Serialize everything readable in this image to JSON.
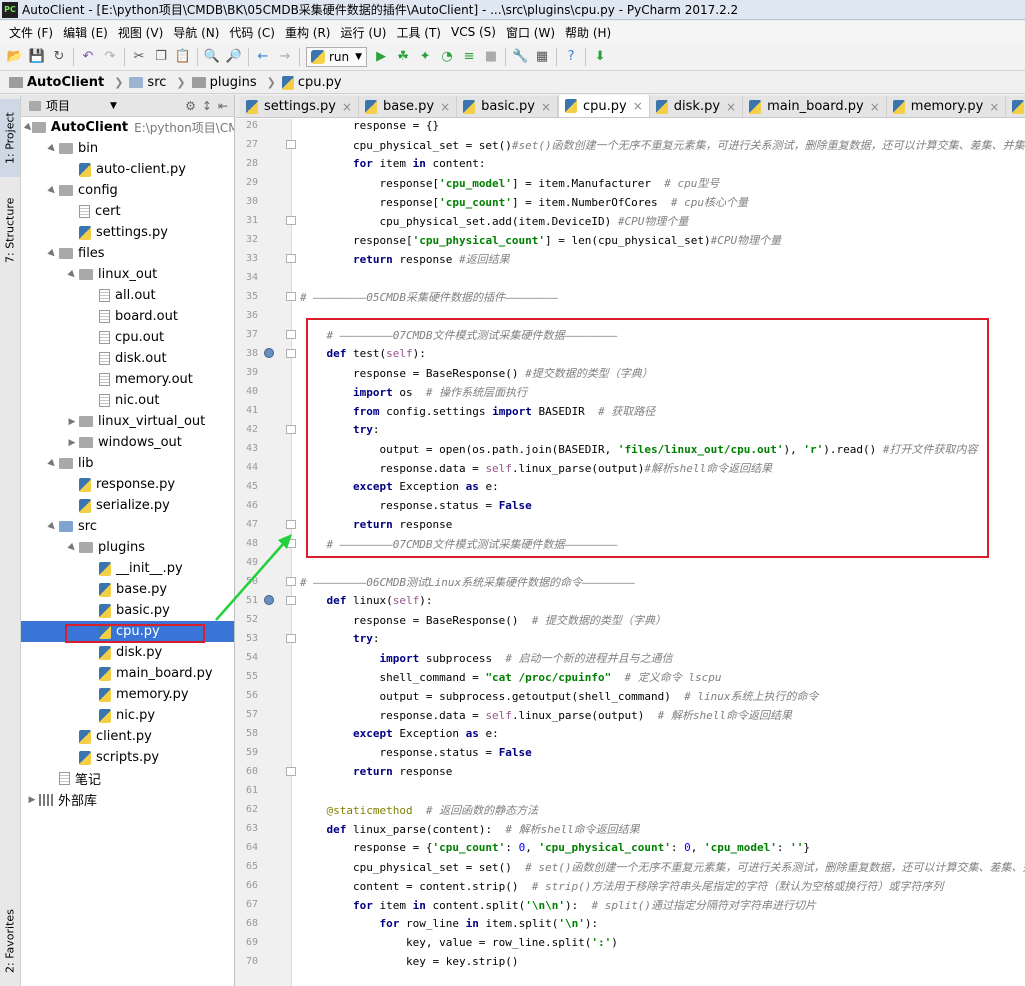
{
  "window": {
    "title": "AutoClient - [E:\\python项目\\CMDB\\BK\\05CMDB采集硬件数据的插件\\AutoClient] - ...\\src\\plugins\\cpu.py - PyCharm 2017.2.2",
    "logo": "PC"
  },
  "menu": [
    "文件 (F)",
    "编辑 (E)",
    "视图 (V)",
    "导航 (N)",
    "代码 (C)",
    "重构 (R)",
    "运行 (U)",
    "工具 (T)",
    "VCS (S)",
    "窗口 (W)",
    "帮助 (H)"
  ],
  "toolbar": {
    "run_config": "run"
  },
  "breadcrumb": [
    "AutoClient",
    "src",
    "plugins",
    "cpu.py"
  ],
  "sidebar_tabs": {
    "project": "1: Project",
    "structure": "7: Structure",
    "favorites": "2: Favorites"
  },
  "project_panel": {
    "title": "项目",
    "root_path": "E:\\python项目\\CMDB",
    "tree": [
      {
        "label": "AutoClient",
        "depth": 0,
        "icon": "folder",
        "expanded": true,
        "bold": true
      },
      {
        "label": "bin",
        "depth": 1,
        "icon": "folder",
        "expanded": true
      },
      {
        "label": "auto-client.py",
        "depth": 2,
        "icon": "py"
      },
      {
        "label": "config",
        "depth": 1,
        "icon": "folder",
        "expanded": true
      },
      {
        "label": "cert",
        "depth": 2,
        "icon": "file"
      },
      {
        "label": "settings.py",
        "depth": 2,
        "icon": "py"
      },
      {
        "label": "files",
        "depth": 1,
        "icon": "folder",
        "expanded": true
      },
      {
        "label": "linux_out",
        "depth": 2,
        "icon": "folder",
        "expanded": true
      },
      {
        "label": "all.out",
        "depth": 3,
        "icon": "file"
      },
      {
        "label": "board.out",
        "depth": 3,
        "icon": "file"
      },
      {
        "label": "cpu.out",
        "depth": 3,
        "icon": "file"
      },
      {
        "label": "disk.out",
        "depth": 3,
        "icon": "file"
      },
      {
        "label": "memory.out",
        "depth": 3,
        "icon": "file"
      },
      {
        "label": "nic.out",
        "depth": 3,
        "icon": "file"
      },
      {
        "label": "linux_virtual_out",
        "depth": 2,
        "icon": "folder",
        "expanded": false
      },
      {
        "label": "windows_out",
        "depth": 2,
        "icon": "folder",
        "expanded": false
      },
      {
        "label": "lib",
        "depth": 1,
        "icon": "folder",
        "expanded": true
      },
      {
        "label": "response.py",
        "depth": 2,
        "icon": "py"
      },
      {
        "label": "serialize.py",
        "depth": 2,
        "icon": "py"
      },
      {
        "label": "src",
        "depth": 1,
        "icon": "folder",
        "expanded": true
      },
      {
        "label": "plugins",
        "depth": 2,
        "icon": "folder",
        "expanded": true
      },
      {
        "label": "__init__.py",
        "depth": 3,
        "icon": "py"
      },
      {
        "label": "base.py",
        "depth": 3,
        "icon": "py"
      },
      {
        "label": "basic.py",
        "depth": 3,
        "icon": "py"
      },
      {
        "label": "cpu.py",
        "depth": 3,
        "icon": "py",
        "selected": true
      },
      {
        "label": "disk.py",
        "depth": 3,
        "icon": "py"
      },
      {
        "label": "main_board.py",
        "depth": 3,
        "icon": "py"
      },
      {
        "label": "memory.py",
        "depth": 3,
        "icon": "py"
      },
      {
        "label": "nic.py",
        "depth": 3,
        "icon": "py"
      },
      {
        "label": "client.py",
        "depth": 2,
        "icon": "py"
      },
      {
        "label": "scripts.py",
        "depth": 2,
        "icon": "py"
      },
      {
        "label": "笔记",
        "depth": 1,
        "icon": "file"
      },
      {
        "label": "外部库",
        "depth": 0,
        "icon": "lib",
        "expanded": false
      }
    ]
  },
  "tabs": [
    {
      "label": "settings.py",
      "active": false
    },
    {
      "label": "base.py",
      "active": false
    },
    {
      "label": "basic.py",
      "active": false
    },
    {
      "label": "cpu.py",
      "active": true
    },
    {
      "label": "disk.py",
      "active": false
    },
    {
      "label": "main_board.py",
      "active": false
    },
    {
      "label": "memory.py",
      "active": false
    },
    {
      "label": "nic.py",
      "active": false
    }
  ],
  "code_lines": [
    {
      "n": "26",
      "html": "        response = {}"
    },
    {
      "n": "27",
      "html": "        cpu_physical_set = set()<span class=\"cm\">#set()函数创建一个无序不重复元素集，可进行关系测试，删除重复数据，还可以计算交集、差集、并集</span>"
    },
    {
      "n": "28",
      "html": "        <span class=\"kw\">for</span> item <span class=\"kw\">in</span> content:"
    },
    {
      "n": "29",
      "html": "            response[<span class=\"str\">'cpu_model'</span>] = item.Manufacturer  <span class=\"cm\"># cpu型号</span>"
    },
    {
      "n": "30",
      "html": "            response[<span class=\"str\">'cpu_count'</span>] = item.NumberOfCores  <span class=\"cm\"># cpu核心个量</span>"
    },
    {
      "n": "31",
      "html": "            cpu_physical_set.add(item.DeviceID) <span class=\"cm\">#CPU物理个量</span>"
    },
    {
      "n": "32",
      "html": "        response[<span class=\"str\">'cpu_physical_count'</span>] = len(cpu_physical_set)<span class=\"cm\">#CPU物理个量</span>"
    },
    {
      "n": "33",
      "html": "        <span class=\"kw\">return</span> response <span class=\"cm\">#返回结果</span>"
    },
    {
      "n": "34",
      "html": ""
    },
    {
      "n": "35",
      "html": "<span class=\"cm\"># ————————05CMDB采集硬件数据的插件————————</span>"
    },
    {
      "n": "36",
      "html": ""
    },
    {
      "n": "37",
      "html": "    <span class=\"cm\"># ————————07CMDB文件模式测试采集硬件数据————————</span>"
    },
    {
      "n": "38",
      "html": "    <span class=\"kw\">def</span> test(<span class=\"self\">self</span>):"
    },
    {
      "n": "39",
      "html": "        response = BaseResponse() <span class=\"cm\">#提交数据的类型（字典）</span>"
    },
    {
      "n": "40",
      "html": "        <span class=\"kw\">import</span> os  <span class=\"cm\"># 操作系统层面执行</span>"
    },
    {
      "n": "41",
      "html": "        <span class=\"kw\">from</span> config.settings <span class=\"kw\">import</span> BASEDIR  <span class=\"cm\"># 获取路径</span>"
    },
    {
      "n": "42",
      "html": "        <span class=\"kw\">try</span>:"
    },
    {
      "n": "43",
      "html": "            output = open(os.path.join(BASEDIR, <span class=\"str\">'files/linux_out/cpu.out'</span>), <span class=\"str\">'r'</span>).read() <span class=\"cm\">#打开文件获取内容</span>"
    },
    {
      "n": "44",
      "html": "            response.data = <span class=\"self\">self</span>.linux_parse(output)<span class=\"cm\">#解析shell命令返回结果</span>"
    },
    {
      "n": "45",
      "html": "        <span class=\"kw\">except</span> Exception <span class=\"kw\">as</span> e:"
    },
    {
      "n": "46",
      "html": "            response.status = <span class=\"kw\">False</span>"
    },
    {
      "n": "47",
      "html": "        <span class=\"kw\">return</span> response"
    },
    {
      "n": "48",
      "html": "    <span class=\"cm\"># ————————07CMDB文件模式测试采集硬件数据————————</span>"
    },
    {
      "n": "49",
      "html": ""
    },
    {
      "n": "50",
      "html": "<span class=\"cm\"># ————————06CMDB测试Linux系统采集硬件数据的命令————————</span>"
    },
    {
      "n": "51",
      "html": "    <span class=\"kw\">def</span> linux(<span class=\"self\">self</span>):"
    },
    {
      "n": "52",
      "html": "        response = BaseResponse()  <span class=\"cm\"># 提交数据的类型（字典）</span>"
    },
    {
      "n": "53",
      "html": "        <span class=\"kw\">try</span>:"
    },
    {
      "n": "54",
      "html": "            <span class=\"kw\">import</span> subprocess  <span class=\"cm\"># 启动一个新的进程并且与之通信</span>"
    },
    {
      "n": "55",
      "html": "            shell_command = <span class=\"str\">\"cat /proc/cpuinfo\"</span>  <span class=\"cm\"># 定义命令 lscpu</span>"
    },
    {
      "n": "56",
      "html": "            output = subprocess.getoutput(shell_command)  <span class=\"cm\"># linux系统上执行的命令</span>"
    },
    {
      "n": "57",
      "html": "            response.data = <span class=\"self\">self</span>.linux_parse(output)  <span class=\"cm\"># 解析shell命令返回结果</span>"
    },
    {
      "n": "58",
      "html": "        <span class=\"kw\">except</span> Exception <span class=\"kw\">as</span> e:"
    },
    {
      "n": "59",
      "html": "            response.status = <span class=\"kw\">False</span>"
    },
    {
      "n": "60",
      "html": "        <span class=\"kw\">return</span> response"
    },
    {
      "n": "61",
      "html": ""
    },
    {
      "n": "62",
      "html": "    <span class=\"dec\">@staticmethod</span>  <span class=\"cm\"># 返回函数的静态方法</span>"
    },
    {
      "n": "63",
      "html": "    <span class=\"kw\">def</span> linux_parse(content):  <span class=\"cm\"># 解析shell命令返回结果</span>"
    },
    {
      "n": "64",
      "html": "        response = {<span class=\"str\">'cpu_count'</span>: <span class=\"num\">0</span>, <span class=\"str\">'cpu_physical_count'</span>: <span class=\"num\">0</span>, <span class=\"str\">'cpu_model'</span>: <span class=\"str\">''</span>}"
    },
    {
      "n": "65",
      "html": "        cpu_physical_set = set()  <span class=\"cm\"># set()函数创建一个无序不重复元素集，可进行关系测试，删除重复数据，还可以计算交集、差集、并</span>"
    },
    {
      "n": "66",
      "html": "        content = content.strip()  <span class=\"cm\"># strip()方法用于移除字符串头尾指定的字符（默认为空格或换行符）或字符序列</span>"
    },
    {
      "n": "67",
      "html": "        <span class=\"kw\">for</span> item <span class=\"kw\">in</span> content.split(<span class=\"str\">'\\n\\n'</span>):  <span class=\"cm\"># split()通过指定分隔符对字符串进行切片</span>"
    },
    {
      "n": "68",
      "html": "            <span class=\"kw\">for</span> row_line <span class=\"kw\">in</span> item.split(<span class=\"str\">'\\n'</span>):"
    },
    {
      "n": "69",
      "html": "                key, value = row_line.split(<span class=\"str\">':'</span>)"
    },
    {
      "n": "70",
      "html": "                key = key.strip()"
    }
  ]
}
